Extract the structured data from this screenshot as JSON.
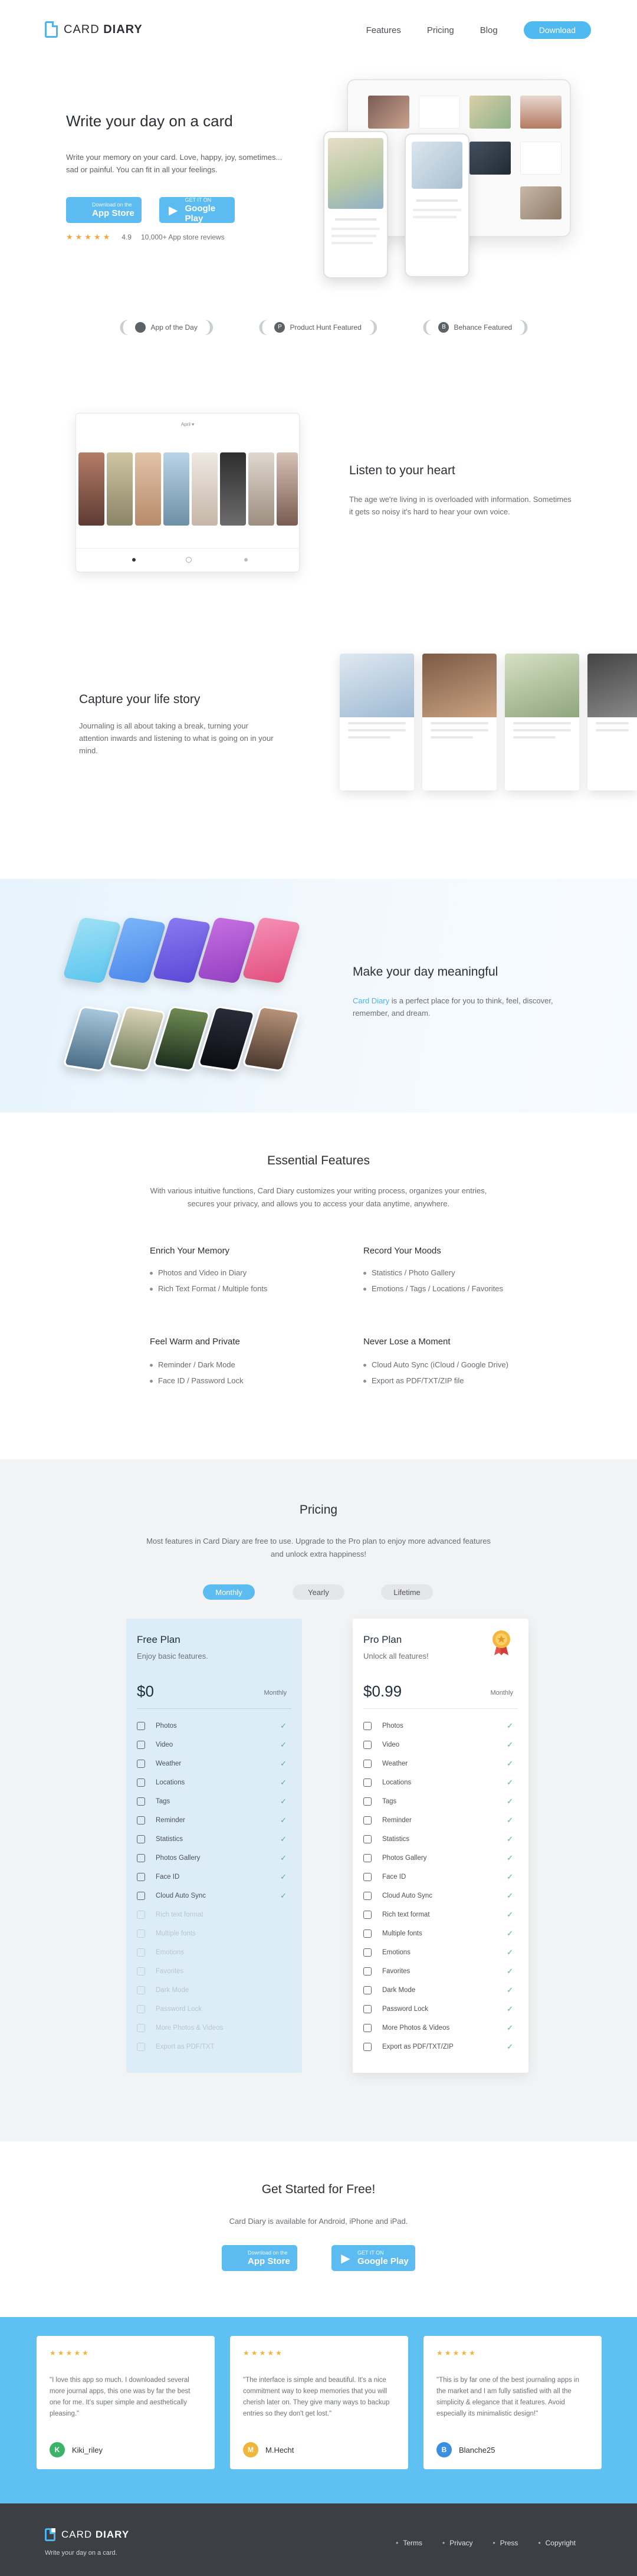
{
  "header": {
    "brand_light": "CARD",
    "brand_bold": "DIARY",
    "nav": [
      "Features",
      "Pricing",
      "Blog"
    ],
    "download": "Download"
  },
  "hero": {
    "title": "Write your day on a card",
    "description": "Write your memory on your card. Love, happy, joy, sometimes... sad or painful. You can fit in all your feelings.",
    "app_store_small": "Download on the",
    "app_store": "App Store",
    "play_small": "GET IT ON",
    "play": "Google Play",
    "rating_value": "4.9",
    "rating_count": "10,000+ App store reviews",
    "stars": "★★★★★"
  },
  "awards": [
    "App of the Day",
    "Product Hunt Featured",
    "Behance Featured"
  ],
  "listen": {
    "title": "Listen to your heart",
    "description": "The age we're living in is overloaded with information. Sometimes it gets so noisy it's hard to hear your own voice.",
    "app_bar_title": "April ▾"
  },
  "capture": {
    "title": "Capture your life story",
    "description": "Journaling is all about taking a break, turning your attention inwards and listening to what is going on in your mind."
  },
  "meaningful": {
    "title": "Make your day meaningful",
    "brand": "Card Diary",
    "description": " is a perfect place for you to think, feel, discover, remember, and dream."
  },
  "essential": {
    "title": "Essential Features",
    "description": "With various intuitive functions, Card Diary customizes your writing process, organizes your entries, secures your privacy, and allows you to access your data anytime, anywhere.",
    "groups": [
      {
        "title": "Enrich Your Memory",
        "items": [
          "Photos and Video in Diary",
          "Rich Text Format / Multiple fonts"
        ]
      },
      {
        "title": "Record Your Moods",
        "items": [
          "Statistics / Photo Gallery",
          "Emotions / Tags / Locations / Favorites"
        ]
      },
      {
        "title": "Feel Warm and Private",
        "items": [
          "Reminder / Dark Mode",
          "Face ID / Password Lock"
        ]
      },
      {
        "title": "Never Lose a Moment",
        "items": [
          "Cloud Auto Sync (iCloud / Google Drive)",
          "Export as PDF/TXT/ZIP file"
        ]
      }
    ]
  },
  "pricing": {
    "title": "Pricing",
    "description": "Most features in Card Diary are free to use. Upgrade to the Pro plan to enjoy more advanced features and unlock extra happiness!",
    "tabs": [
      "Monthly",
      "Yearly",
      "Lifetime"
    ],
    "free": {
      "name": "Free Plan",
      "sub": "Enjoy basic features.",
      "price": "$0",
      "per": "Monthly",
      "features": [
        "Photos",
        "Video",
        "Weather",
        "Locations",
        "Tags",
        "Reminder",
        "Statistics",
        "Photos Gallery",
        "Face ID",
        "Cloud Auto Sync",
        "Rich text format",
        "Multiple fonts",
        "Emotions",
        "Favorites",
        "Dark Mode",
        "Password Lock",
        "More Photos & Videos",
        "Export as PDF/TXT"
      ],
      "included": 10
    },
    "pro": {
      "name": "Pro Plan",
      "sub": "Unlock all features!",
      "price": "$0.99",
      "per": "Monthly",
      "features": [
        "Photos",
        "Video",
        "Weather",
        "Locations",
        "Tags",
        "Reminder",
        "Statistics",
        "Photos Gallery",
        "Face ID",
        "Cloud Auto Sync",
        "Rich text format",
        "Multiple fonts",
        "Emotions",
        "Favorites",
        "Dark Mode",
        "Password Lock",
        "More Photos & Videos",
        "Export as PDF/TXT/ZIP"
      ],
      "included": 18
    }
  },
  "get_started": {
    "title": "Get Started for Free!",
    "description": "Card Diary is available for Android, iPhone and iPad."
  },
  "testimonials": [
    {
      "text": "\"I love this app so much. I downloaded several more journal apps, this one was by far the best one for me. It's super simple and aesthetically pleasing.\"",
      "user": "Kiki_riley",
      "initial": "K",
      "color": "#3bb46a"
    },
    {
      "text": "\"The interface is simple and beautiful. It's a nice commitment way to keep memories that you will cherish later on. They give many ways to backup entries so they don't get lost.\"",
      "user": "M.Hecht",
      "initial": "M",
      "color": "#f0b63c"
    },
    {
      "text": "\"This is by far one of the best journaling apps in the market and I am fully satisfied with all the simplicity & elegance that it features. Avoid especially its minimalistic design!\"",
      "user": "Blanche25",
      "initial": "B",
      "color": "#3c8fe0"
    }
  ],
  "footer": {
    "tagline": "Write your day on a card.",
    "links": [
      "Terms",
      "Privacy",
      "Press",
      "Copyright"
    ]
  },
  "colors": {
    "accent": "#4fb9f0",
    "testimonial_bg": "#5fc1f2",
    "footer_bg": "#3c3f44"
  }
}
